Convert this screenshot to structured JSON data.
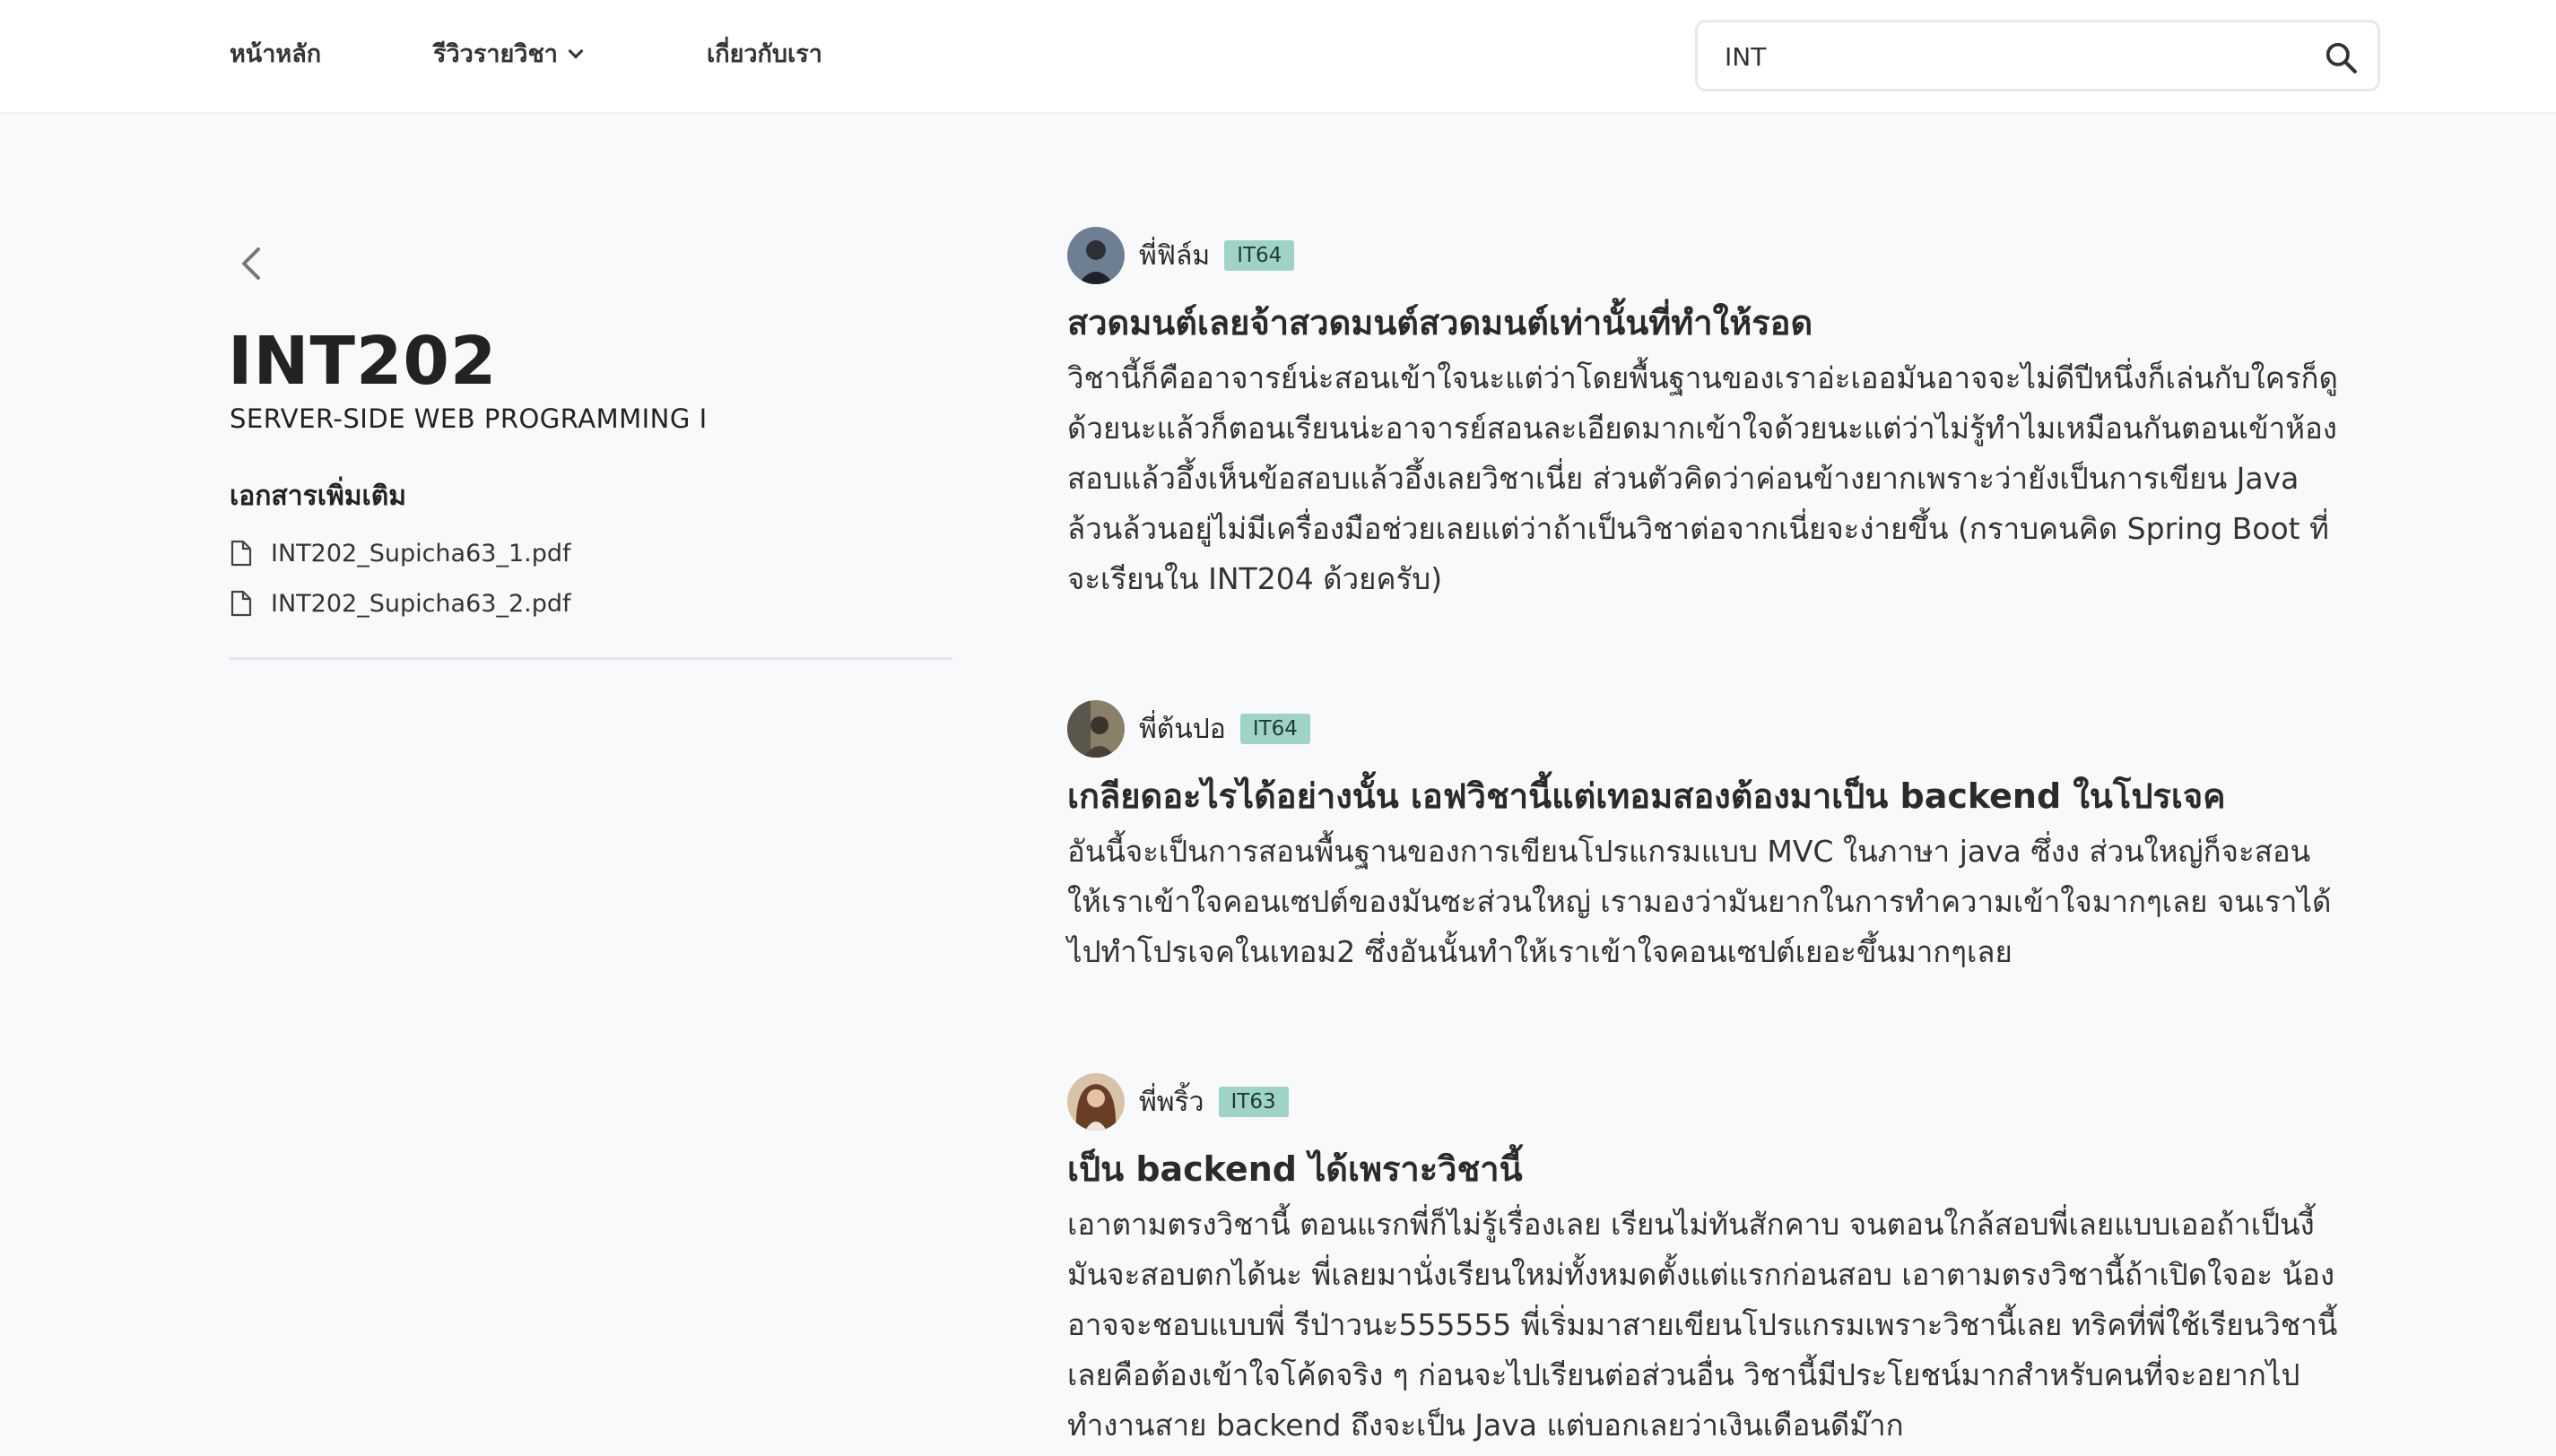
{
  "nav": {
    "home": "หน้าหลัก",
    "reviews": "รีวิวรายวิชา",
    "about": "เกี่ยวกับเรา"
  },
  "search": {
    "value": "INT",
    "icon": "search-icon"
  },
  "course": {
    "code": "INT202",
    "name": "SERVER-SIDE WEB PROGRAMMING I",
    "docs_heading": "เอกสารเพิ่มเติม",
    "documents": [
      "INT202_Supicha63_1.pdf",
      "INT202_Supicha63_2.pdf"
    ]
  },
  "reviews": [
    {
      "author": "พี่ฟิล์ม",
      "generation": "IT64",
      "title": "สวดมนต์เลยจ้าสวดมนต์สวดมนต์เท่านั้นที่ทำให้รอด",
      "body": "วิชานี้ก็คืออาจารย์น่ะสอนเข้าใจนะแต่ว่าโดยพื้นฐานของเราอ่ะเออมันอาจจะไม่ดีปีหนึ่งก็เล่นกับใครก็ดูด้วยนะแล้วก็ตอนเรียนน่ะอาจารย์สอนละเอียดมากเข้าใจด้วยนะแต่ว่าไม่รู้ทำไมเหมือนกันตอนเข้าห้องสอบแล้วอึ้งเห็นข้อสอบแล้วอึ้งเลยวิชาเนี่ย ส่วนตัวคิดว่าค่อนข้างยากเพราะว่ายังเป็นการเขียน Java ล้วนล้วนอยู่ไม่มีเครื่องมือช่วยเลยแต่ว่าถ้าเป็นวิชาต่อจากเนี่ยจะง่ายขึ้น (กราบคนคิด Spring Boot ที่จะเรียนใน INT204 ด้วยครับ)"
    },
    {
      "author": "พี่ต้นปอ",
      "generation": "IT64",
      "title": "เกลียดอะไรได้อย่างนั้น เอฟวิชานี้แต่เทอมสองต้องมาเป็น backend ในโปรเจค",
      "body": "อันนี้จะเป็นการสอนพื้นฐานของการเขียนโปรแกรมแบบ MVC ในภาษา java ซึ่งง ส่วนใหญ่ก็จะสอนให้เราเข้าใจคอนเซปต์ของมันซะส่วนใหญ่ เรามองว่ามันยากในการทำความเข้าใจมากๆเลย จนเราได้ไปทำโปรเจคในเทอม2 ซึ่งอันนั้นทำให้เราเข้าใจคอนเซปต์เยอะขึ้นมากๆเลย"
    },
    {
      "author": "พี่พริ้ว",
      "generation": "IT63",
      "title": "เป็น backend ได้เพราะวิชานี้",
      "body": "เอาตามตรงวิชานี้ ตอนแรกพี่ก็ไม่รู้เรื่องเลย เรียนไม่ทันสักคาบ จนตอนใกล้สอบพี่เลยแบบเออถ้าเป็นงี้มันจะสอบตกได้นะ พี่เลยมานั่งเรียนใหม่ทั้งหมดตั้งแต่แรกก่อนสอบ เอาตามตรงวิชานี้ถ้าเปิดใจอะ น้องอาจจะชอบแบบพี่ รีป่าวนะ555555 พี่เริ่มมาสายเขียนโปรแกรมเพราะวิชานี้เลย ทริคที่พี่ใช้เรียนวิชานี้เลยคือต้องเข้าใจโค้ดจริง ๆ ก่อนจะไปเรียนต่อส่วนอื่น วิชานี้มีประโยชน์มากสำหรับคนที่จะอยากไปทำงานสาย backend ถึงจะเป็น Java แต่บอกเลยว่าเงินเดือนดีม๊าก"
    }
  ]
}
